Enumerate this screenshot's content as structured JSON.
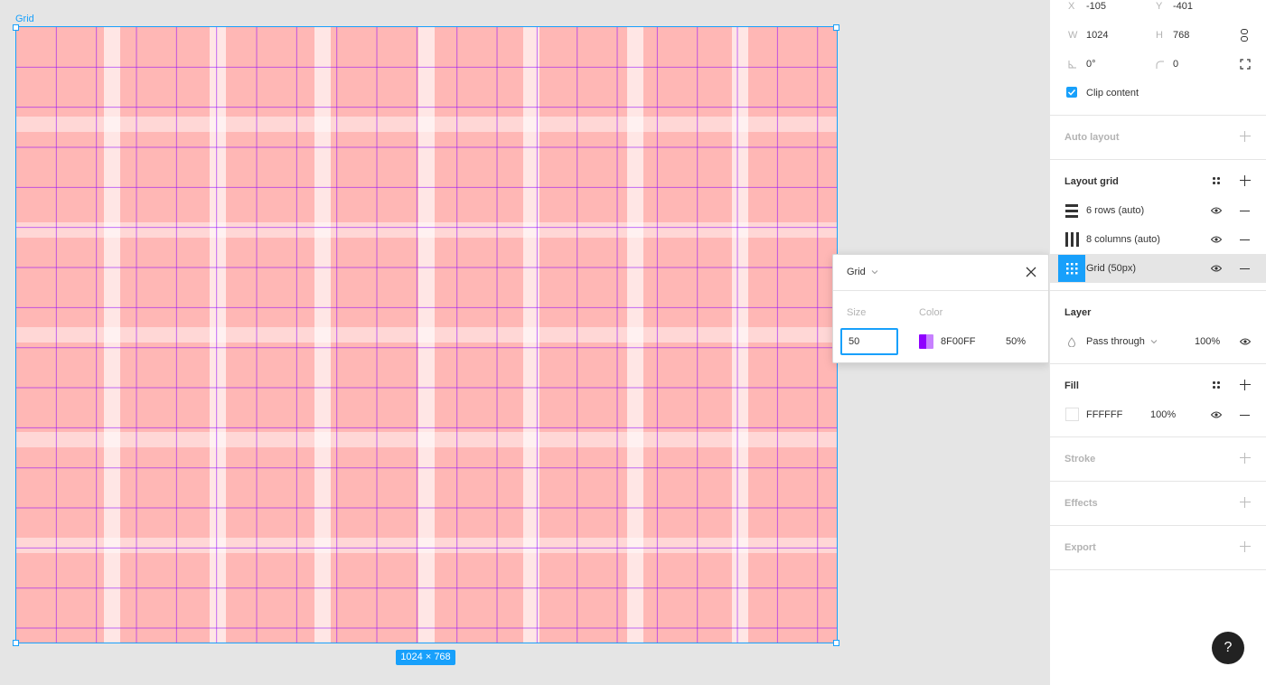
{
  "canvas": {
    "frame_name": "Grid",
    "size_badge": "1024 × 768"
  },
  "design": {
    "x_label": "X",
    "x_value": "-105",
    "y_label": "Y",
    "y_value": "-401",
    "w_label": "W",
    "w_value": "1024",
    "h_label": "H",
    "h_value": "768",
    "rotation_value": "0°",
    "radius_value": "0",
    "clip_content_label": "Clip content",
    "clip_content_checked": true
  },
  "auto_layout": {
    "title": "Auto layout"
  },
  "layout_grid": {
    "title": "Layout grid",
    "items": [
      {
        "label": "6 rows (auto)",
        "icon": "rows-grid-icon"
      },
      {
        "label": "8 columns (auto)",
        "icon": "columns-grid-icon"
      },
      {
        "label": "Grid (50px)",
        "icon": "uniform-grid-icon"
      }
    ]
  },
  "layer": {
    "title": "Layer",
    "blend_mode": "Pass through",
    "opacity": "100%"
  },
  "fill": {
    "title": "Fill",
    "hex": "FFFFFF",
    "opacity": "100%",
    "color": "#FFFFFF"
  },
  "stroke": {
    "title": "Stroke"
  },
  "effects": {
    "title": "Effects"
  },
  "export": {
    "title": "Export"
  },
  "grid_popup": {
    "type_label": "Grid",
    "size_label": "Size",
    "size_value": "50",
    "color_label": "Color",
    "color_hex": "8F00FF",
    "color_opacity": "50%",
    "color": "#8F00FF"
  },
  "help": {
    "label": "?"
  },
  "colors": {
    "accent": "#18A0FB",
    "grid_line": "#8F00FF",
    "row_band": "#FFFFFF",
    "column_band": "#FFFFFF",
    "frame_fill": "#FFB7B5"
  }
}
